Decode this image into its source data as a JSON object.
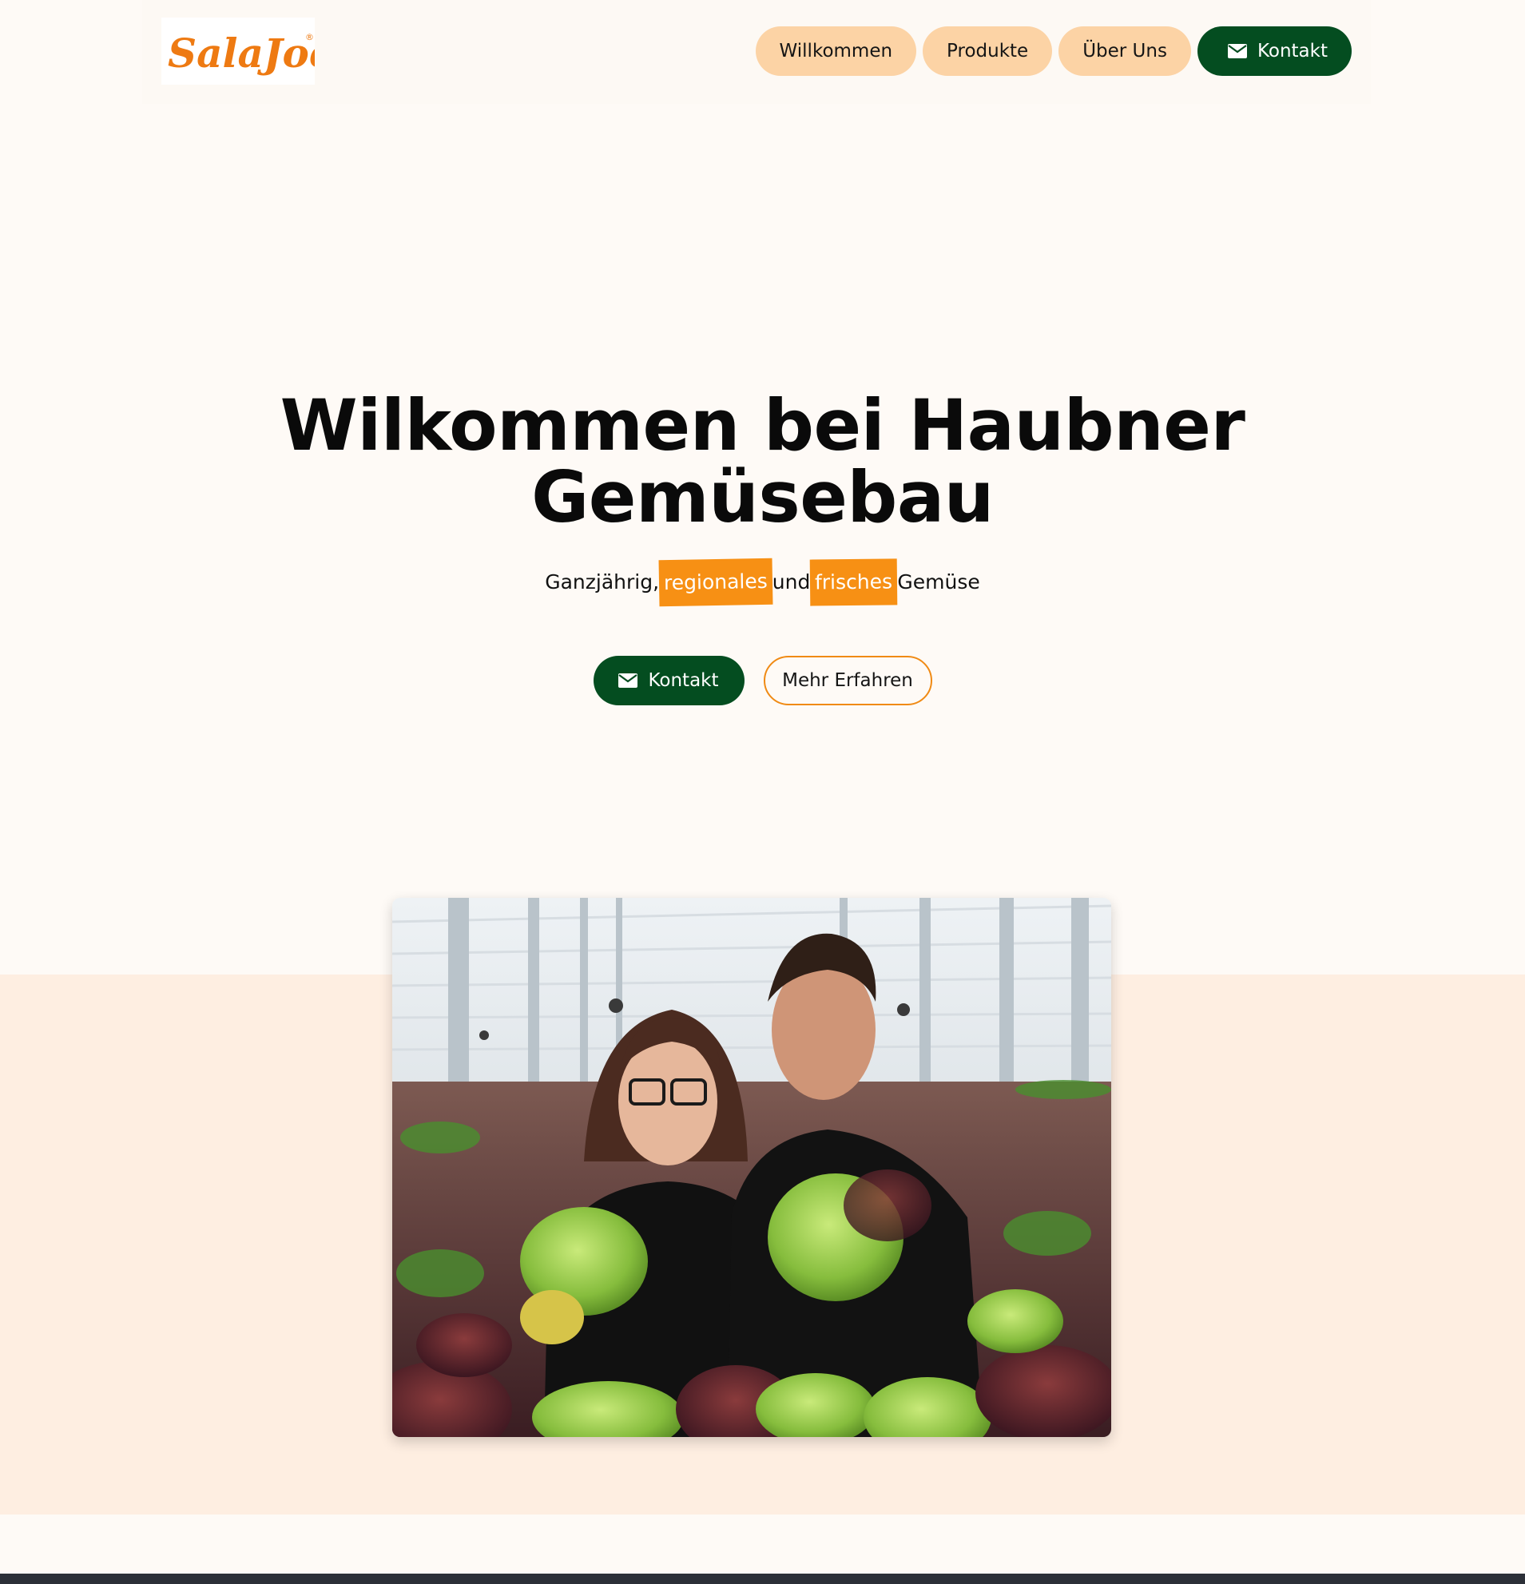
{
  "brand": {
    "logo_text": "SalaJoe",
    "logo_mark": "®",
    "logo_color": "#ee7a12"
  },
  "nav": {
    "items": [
      {
        "label": "Willkommen"
      },
      {
        "label": "Produkte"
      },
      {
        "label": "Über Uns"
      }
    ],
    "contact": {
      "label": "Kontakt",
      "icon": "envelope-icon"
    }
  },
  "hero": {
    "title_line1": "Wilkommen bei Haubner",
    "title_line2": "Gemüsebau",
    "subtitle": {
      "part1": "Ganzjährig,",
      "highlight1": "regionales",
      "part2": "und",
      "highlight2": "frisches",
      "part3": "Gemüse"
    },
    "primary_cta": {
      "label": "Kontakt",
      "icon": "envelope-icon"
    },
    "secondary_cta": {
      "label": "Mehr Erfahren"
    }
  },
  "colors": {
    "page_bg": "#fefaf6",
    "band_bg": "#feeee1",
    "nav_pill": "#fcd3a5",
    "dark_green": "#044d20",
    "highlight_orange": "#f79014"
  }
}
